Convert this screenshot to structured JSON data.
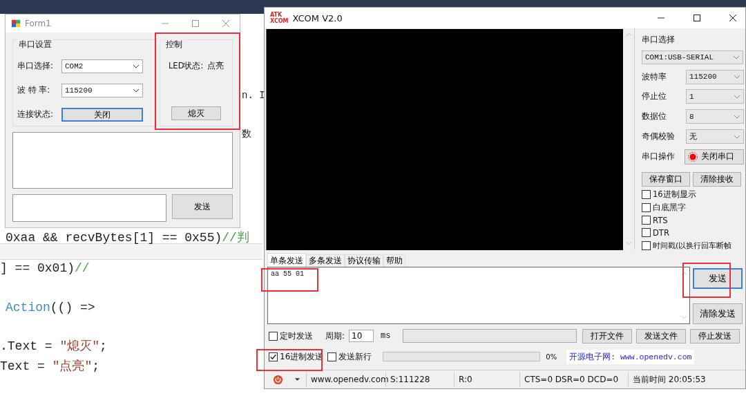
{
  "editor": {
    "fragments_right": [
      "n. I",
      "数"
    ],
    "lines": [
      {
        "tokens": [
          {
            "kind": "plain",
            "text": "0xaa && recvBytes[1] == 0x55)"
          },
          {
            "kind": "comment",
            "text": "//判"
          }
        ]
      },
      {
        "tokens": [
          {
            "kind": "plain",
            "text": "] == 0x01)"
          },
          {
            "kind": "comment",
            "text": "//"
          }
        ]
      },
      {
        "tokens": [
          {
            "kind": "type",
            "text": "Action"
          },
          {
            "kind": "plain",
            "text": "(() =>"
          }
        ]
      },
      {
        "tokens": [
          {
            "kind": "plain",
            "text": ".Text = "
          },
          {
            "kind": "string",
            "text": "\"熄灭\""
          },
          {
            "kind": "plain",
            "text": ";"
          }
        ]
      },
      {
        "tokens": [
          {
            "kind": "plain",
            "text": "Text = "
          },
          {
            "kind": "string",
            "text": "\"点亮\""
          },
          {
            "kind": "plain",
            "text": ";"
          }
        ]
      }
    ]
  },
  "form1": {
    "title": "Form1",
    "serial_group": {
      "title": "串口设置",
      "rows": [
        {
          "kind": "combo",
          "label": "串口选择:",
          "value": "COM2"
        },
        {
          "kind": "combo",
          "label": "波 特 率:",
          "value": "115200"
        },
        {
          "kind": "button",
          "label": "连接状态:",
          "value": "关闭",
          "focused": true
        }
      ]
    },
    "control_group": {
      "title": "控制",
      "status_label": "LED状态:",
      "status_value": "点亮",
      "button": "熄灭"
    },
    "send_button": "发送"
  },
  "xcom": {
    "title": "XCOM V2.0",
    "logo_top": "ATK",
    "logo_bottom": "XCOM",
    "port_label": "串口选择",
    "port_value": "COM1:USB-SERIAL",
    "settings": [
      {
        "label": "波特率",
        "value": "115200"
      },
      {
        "label": "停止位",
        "value": "1"
      },
      {
        "label": "数据位",
        "value": "8"
      },
      {
        "label": "奇偶校验",
        "value": "无"
      }
    ],
    "port_op": {
      "label": "串口操作",
      "button": "关闭串口",
      "on": true
    },
    "buttons": [
      "保存窗口",
      "清除接收"
    ],
    "options": [
      {
        "label": "16进制显示",
        "checked": false
      },
      {
        "label": "白底黑字",
        "checked": false
      },
      {
        "label": "RTS",
        "checked": false
      },
      {
        "label": "DTR",
        "checked": false
      },
      {
        "label": "时间戳(以换行回车断帧",
        "checked": false
      }
    ],
    "tabs": [
      {
        "label": "单条发送",
        "selected": true
      },
      {
        "label": "多条发送",
        "selected": false
      },
      {
        "label": "协议传输",
        "selected": false
      },
      {
        "label": "帮助",
        "selected": false
      }
    ],
    "send_text": "aa 55 01",
    "send_button": {
      "label": "发送",
      "focused": true
    },
    "clear_send": "清除发送",
    "timer": {
      "label": "定时发送",
      "checked": false
    },
    "period_label": "周期:",
    "period_value": "10",
    "period_unit": "ms",
    "file_buttons": [
      "打开文件",
      "发送文件",
      "停止发送"
    ],
    "hex_send": {
      "label": "16进制发送",
      "checked": true
    },
    "newline": {
      "label": "发送新行",
      "checked": false
    },
    "progress": {
      "level": 0,
      "reading": "0%"
    },
    "site_banner": "开源电子网: www.openedv.com",
    "status": [
      "www.openedv.com",
      "S:111228",
      "R:0",
      "CTS=0 DSR=0 DCD=0",
      "当前时间 20:05:53"
    ]
  }
}
